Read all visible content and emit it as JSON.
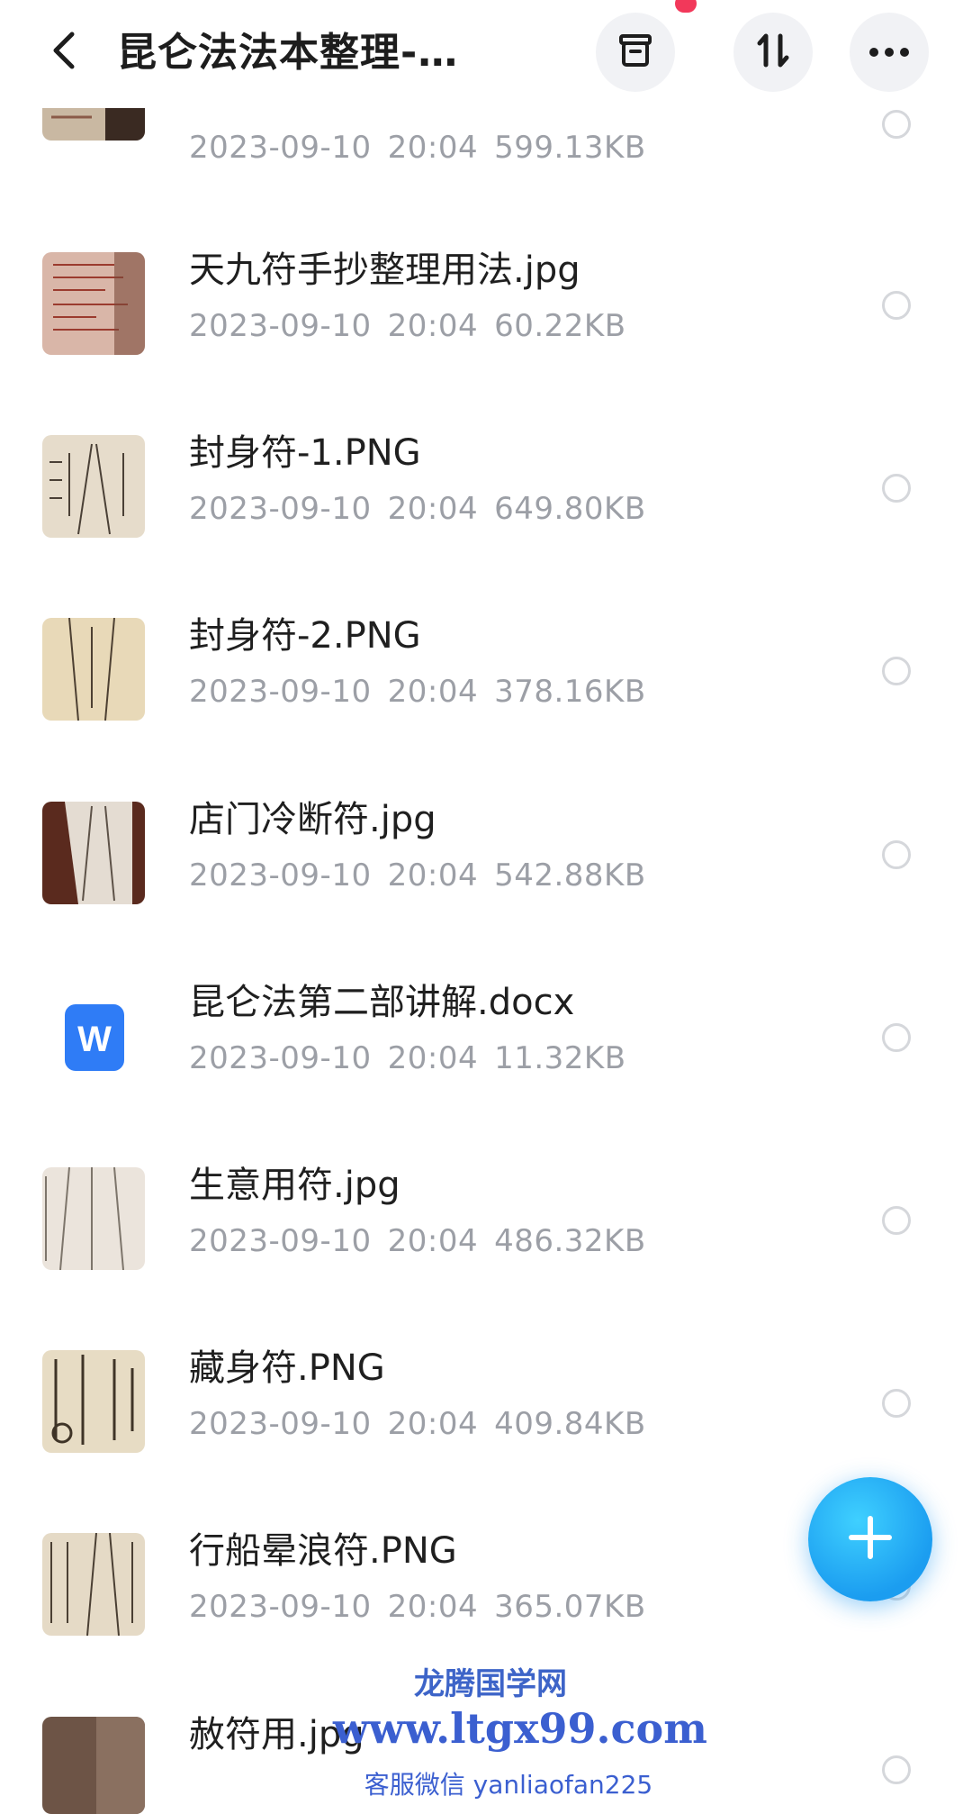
{
  "header": {
    "title": "昆仑法法本整理-…",
    "back_icon": "chevron-left-icon",
    "actions": [
      {
        "name": "archive",
        "icon": "archive-box-icon"
      },
      {
        "name": "sort",
        "icon": "sort-arrows-icon"
      },
      {
        "name": "more",
        "icon": "more-dots-icon"
      }
    ]
  },
  "files": [
    {
      "name": "",
      "date": "2023-09-10",
      "time": "20:04",
      "size": "599.13KB",
      "type": "image"
    },
    {
      "name": "天九符手抄整理用法.jpg",
      "date": "2023-09-10",
      "time": "20:04",
      "size": "60.22KB",
      "type": "image"
    },
    {
      "name": "封身符-1.PNG",
      "date": "2023-09-10",
      "time": "20:04",
      "size": "649.80KB",
      "type": "image"
    },
    {
      "name": "封身符-2.PNG",
      "date": "2023-09-10",
      "time": "20:04",
      "size": "378.16KB",
      "type": "image"
    },
    {
      "name": "店门冷断符.jpg",
      "date": "2023-09-10",
      "time": "20:04",
      "size": "542.88KB",
      "type": "image"
    },
    {
      "name": "昆仑法第二部讲解.docx",
      "date": "2023-09-10",
      "time": "20:04",
      "size": "11.32KB",
      "type": "docx"
    },
    {
      "name": "生意用符.jpg",
      "date": "2023-09-10",
      "time": "20:04",
      "size": "486.32KB",
      "type": "image"
    },
    {
      "name": "藏身符.PNG",
      "date": "2023-09-10",
      "time": "20:04",
      "size": "409.84KB",
      "type": "image"
    },
    {
      "name": "行船晕浪符.PNG",
      "date": "2023-09-10",
      "time": "20:04",
      "size": "365.07KB",
      "type": "image"
    },
    {
      "name": "赦符用.jpg",
      "date": "",
      "time": "",
      "size": "",
      "type": "image"
    }
  ],
  "fab": {
    "icon": "plus-icon"
  },
  "watermark": {
    "line1": "龙腾国学网",
    "line2": "www.ltgx99.com",
    "line3": "客服微信 yanliaofan225"
  },
  "colors": {
    "accent": "#1b9df0",
    "meta_text": "#9c9fa6",
    "watermark": "#3b5fd0",
    "notification": "#f2385a",
    "docx_icon": "#2f7cf6"
  }
}
